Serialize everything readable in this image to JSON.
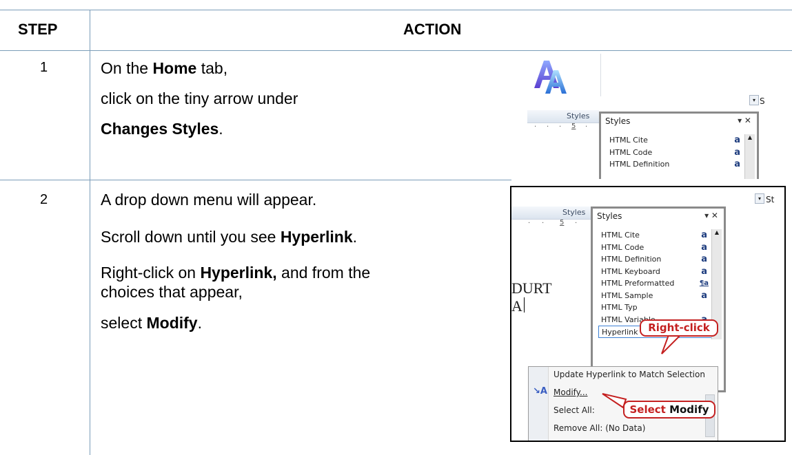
{
  "table": {
    "header": {
      "step": "STEP",
      "action": "ACTION"
    },
    "rows": [
      {
        "step": "1",
        "lines": [
          {
            "pre": "On the ",
            "bold": "Home",
            "post": " tab,"
          },
          {
            "pre": "click on the tiny arrow under",
            "bold": "",
            "post": ""
          },
          {
            "pre": "",
            "bold": "Changes Styles",
            "post": "."
          }
        ]
      },
      {
        "step": "2",
        "lines": [
          {
            "pre": "A drop down menu will appear.",
            "bold": "",
            "post": ""
          },
          {
            "pre": "Scroll down until you see ",
            "bold": "Hyperlink",
            "post": "."
          },
          {
            "pre": "Right-click on ",
            "bold": "Hyperlink,",
            "post": " and from the"
          },
          {
            "pre": "choices that appear,",
            "bold": "",
            "post": ""
          },
          {
            "pre": "select ",
            "bold": "Modify",
            "post": "."
          }
        ]
      }
    ]
  },
  "screenshot1": {
    "group_label": "Styles",
    "ruler_mark": "5",
    "pane_title": "Styles",
    "items": [
      {
        "name": "HTML Cite",
        "mark": "a"
      },
      {
        "name": "HTML Code",
        "mark": "a"
      },
      {
        "name": "HTML Definition",
        "mark": "a"
      }
    ]
  },
  "screenshot2": {
    "group_label": "Styles",
    "ruler_mark": "5",
    "pane_title": "Styles",
    "doc_text_1": "DURT",
    "doc_text_2": "A",
    "items": [
      {
        "name": "HTML Cite",
        "mark": "a"
      },
      {
        "name": "HTML Code",
        "mark": "a"
      },
      {
        "name": "HTML Definition",
        "mark": "a"
      },
      {
        "name": "HTML Keyboard",
        "mark": "a"
      },
      {
        "name": "HTML Preformatted",
        "mark": "¶a"
      },
      {
        "name": "HTML Sample",
        "mark": "a"
      },
      {
        "name": "HTML Typ",
        "mark": ""
      },
      {
        "name": "HTML Variable",
        "mark": "a"
      }
    ],
    "selected_item": "Hyperlink",
    "callout_right_click": "Right-click",
    "menu": {
      "update": "Update Hyperlink to Match Selection",
      "modify": "Modify...",
      "select_all": "Select All:",
      "remove_all": "Remove All: (No Data)"
    },
    "callout_select_pre": "Select",
    "callout_select_bold": "Modify"
  },
  "colors": {
    "accent_red": "#c42020",
    "table_line": "#7a9cb8",
    "style_mark": "#1d3c7e"
  }
}
